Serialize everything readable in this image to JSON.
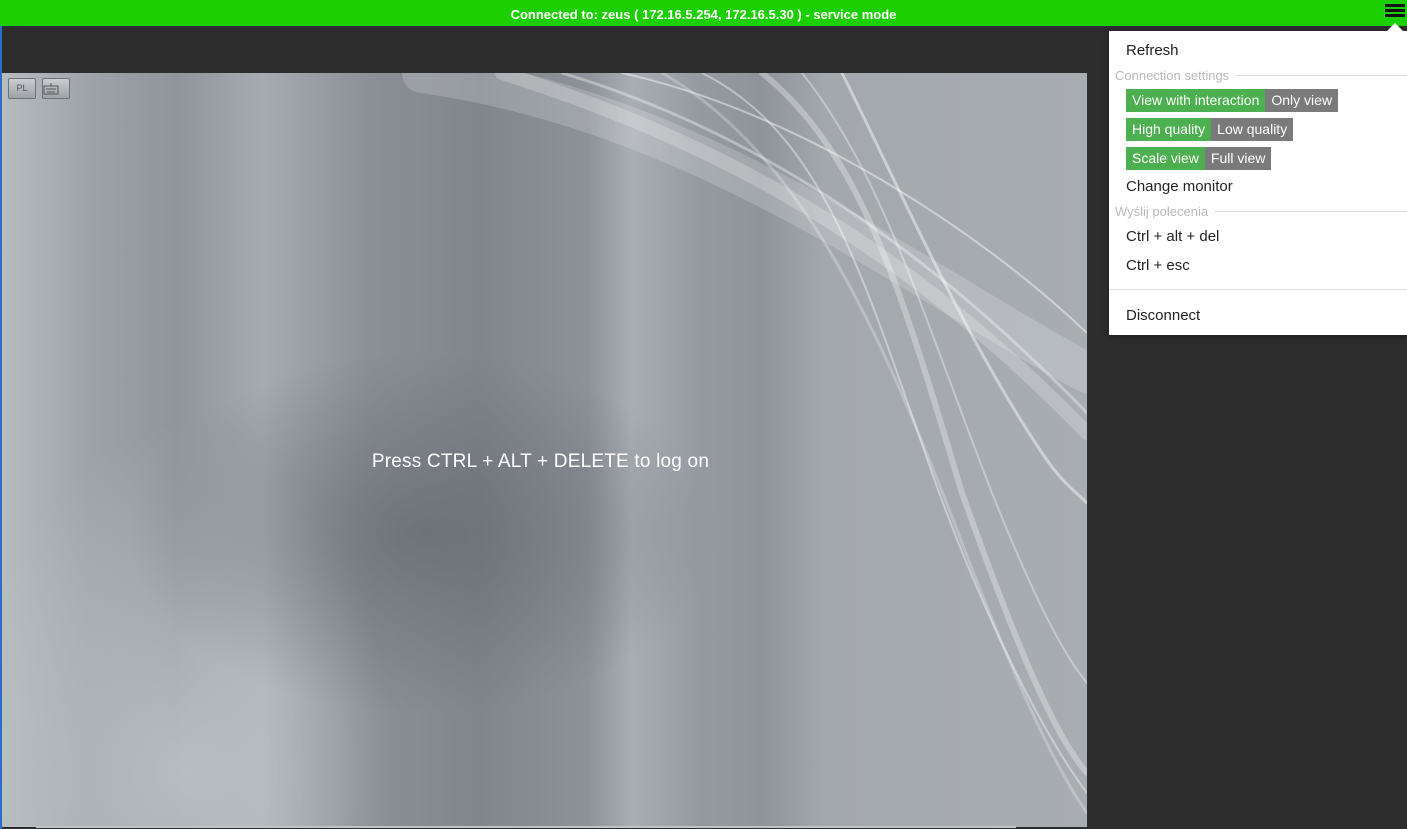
{
  "status_bar": {
    "text": "Connected to: zeus ( 172.16.5.254, 172.16.5.30 ) - service mode",
    "color": "#1ccf00",
    "menu_icon": "hamburger-icon"
  },
  "remote_screen": {
    "logon_message": "Press CTRL + ALT + DELETE to log on",
    "buttons": [
      {
        "label": "PL",
        "icon": "language-icon"
      },
      {
        "label": "",
        "icon": "keyboard-icon"
      }
    ]
  },
  "menu": {
    "refresh": "Refresh",
    "connection_settings": {
      "title": "Connection settings",
      "interaction": {
        "on": "View with interaction",
        "off": "Only view"
      },
      "quality": {
        "on": "High quality",
        "off": "Low quality"
      },
      "scaling": {
        "on": "Scale view",
        "off": "Full view"
      },
      "change_monitor": "Change monitor"
    },
    "send_commands": {
      "title": "Wyślij polecenia",
      "ctrl_alt_del": "Ctrl + alt + del",
      "ctrl_esc": "Ctrl + esc"
    },
    "disconnect": "Disconnect",
    "active_color": "#4caf50",
    "inactive_color": "#7a7a7a"
  }
}
